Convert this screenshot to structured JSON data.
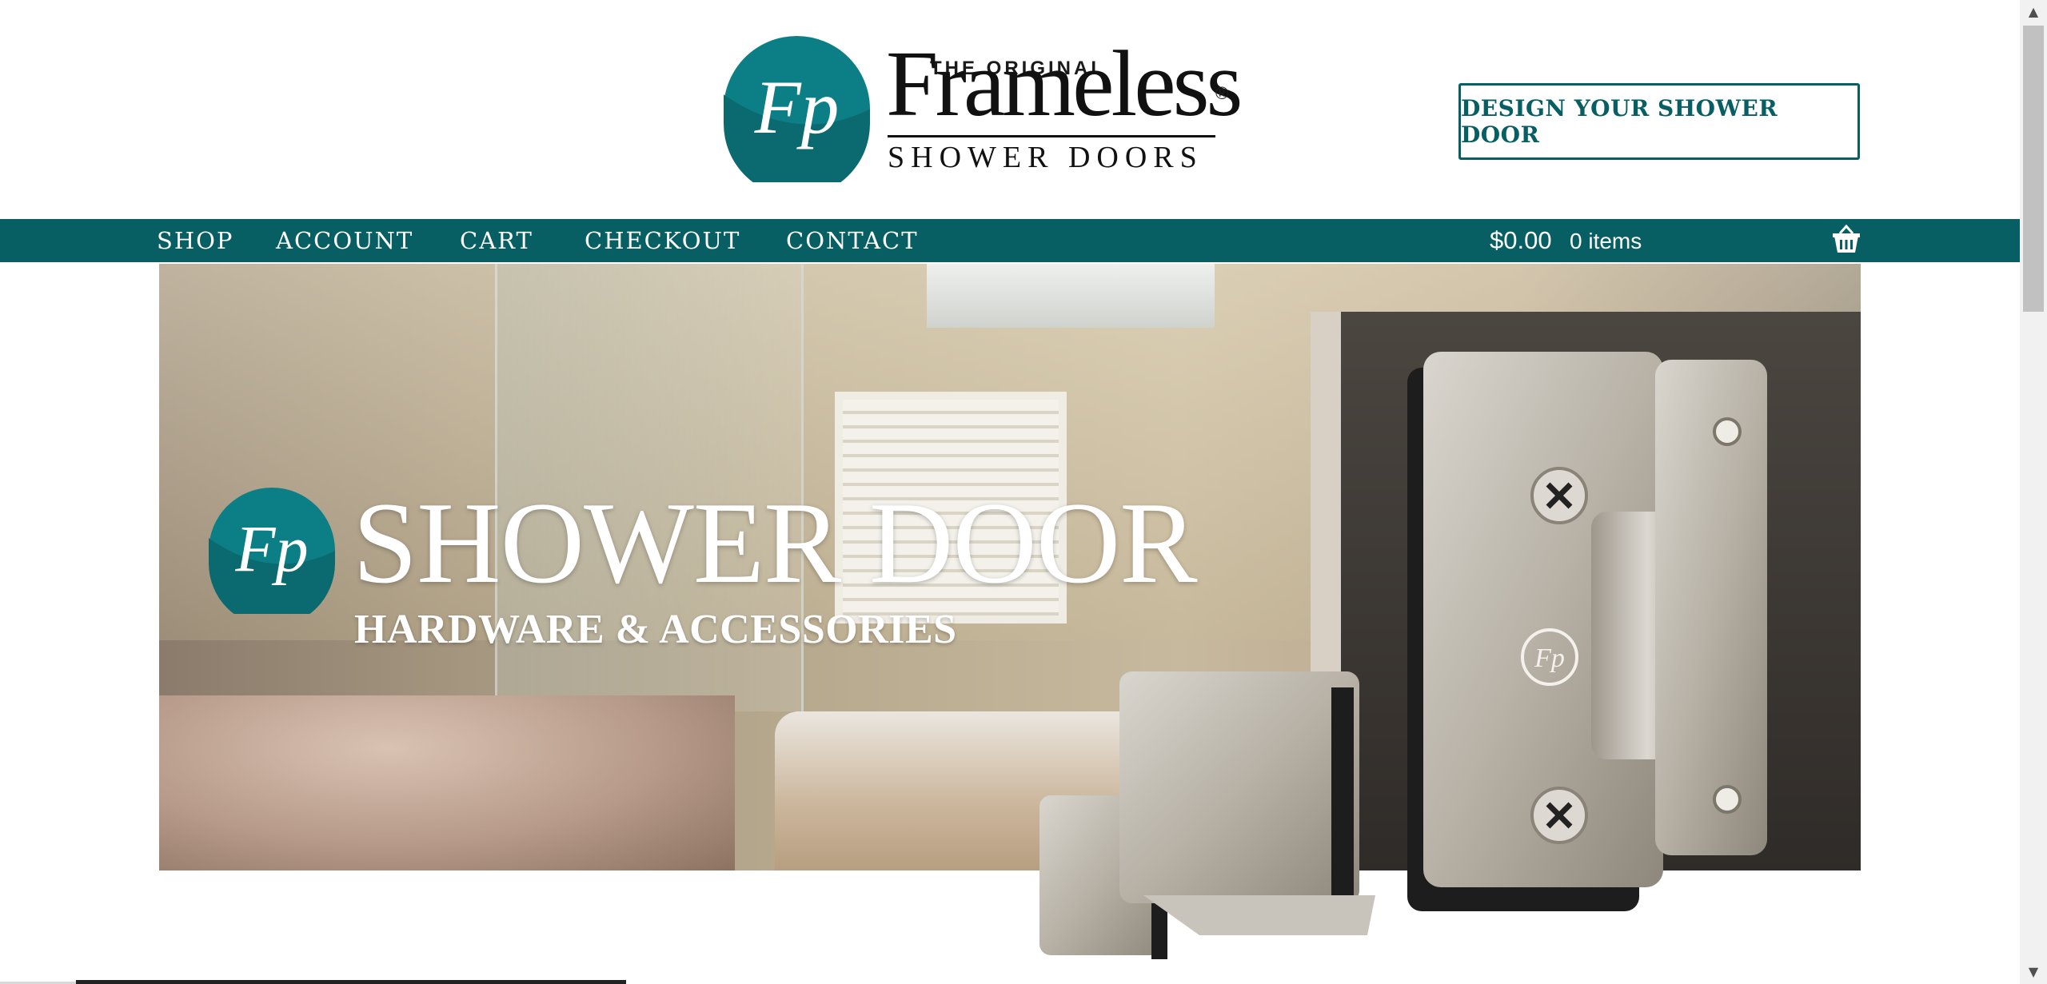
{
  "header": {
    "logo": {
      "tagline_small": "THE ORIGINAL",
      "wordmark": "Frameless",
      "registered": "®",
      "subline": "SHOWER DOORS",
      "monogram": "Fp"
    },
    "design_button": "DESIGN YOUR SHOWER DOOR"
  },
  "nav": {
    "items": [
      {
        "label": "SHOP"
      },
      {
        "label": "ACCOUNT"
      },
      {
        "label": "CART"
      },
      {
        "label": "CHECKOUT"
      },
      {
        "label": "CONTACT"
      }
    ],
    "cart_total": "$0.00",
    "cart_count": "0 items",
    "basket_icon": "basket-icon"
  },
  "hero": {
    "title": "SHOWER DOOR",
    "subtitle": "HARDWARE & ACCESSORIES",
    "monogram": "Fp"
  },
  "colors": {
    "brand_teal": "#075e63",
    "white": "#ffffff"
  }
}
